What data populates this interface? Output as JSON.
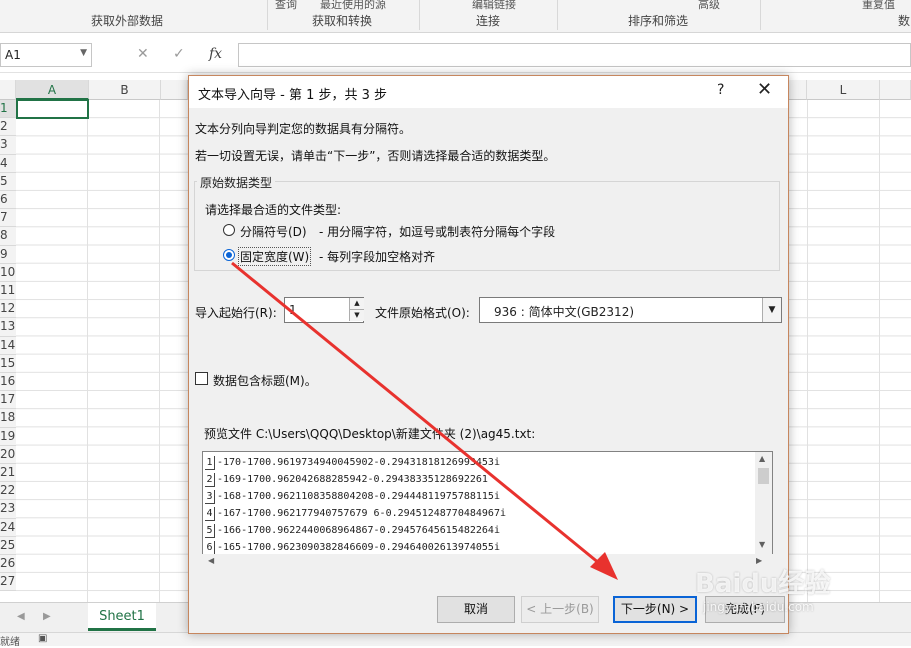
{
  "ribbon": {
    "groups": [
      "获取外部数据",
      "获取和转换",
      "连接",
      "排序和筛选",
      "数"
    ],
    "top_partial": [
      "查询",
      "最近使用的源",
      "编辑链接",
      "高级",
      "重复值"
    ]
  },
  "formula_bar": {
    "name_box": "A1",
    "cancel_icon": "✕",
    "enter_icon": "✓",
    "fx_icon": "fx"
  },
  "sheet": {
    "columns": [
      "A",
      "B",
      "L"
    ],
    "rows": [
      "1",
      "2",
      "3",
      "4",
      "5",
      "6",
      "7",
      "8",
      "9",
      "10",
      "11",
      "12",
      "13",
      "14",
      "15",
      "16",
      "17",
      "18",
      "19",
      "20",
      "21",
      "22",
      "23",
      "24",
      "25",
      "26",
      "27"
    ],
    "tab": "Sheet1",
    "status": "就绪"
  },
  "dialog": {
    "title": "文本导入向导 - 第 1 步，共 3 步",
    "help": "?",
    "close": "✕",
    "intro1": "文本分列向导判定您的数据具有分隔符。",
    "intro2": "若一切设置无误，请单击“下一步”，否则请选择最合适的数据类型。",
    "group_title": "原始数据类型",
    "choose_label": "请选择最合适的文件类型:",
    "option_delimited": "分隔符号(D)",
    "option_delimited_desc": "- 用分隔字符，如逗号或制表符分隔每个字段",
    "option_fixed": "固定宽度(W)",
    "option_fixed_desc": "- 每列字段加空格对齐",
    "start_row_label": "导入起始行(R):",
    "start_row_value": "1",
    "origin_label": "文件原始格式(O):",
    "origin_value": "936 : 简体中文(GB2312)",
    "header_checkbox": "数据包含标题(M)。",
    "preview_label": "预览文件 C:\\Users\\QQQ\\Desktop\\新建文件夹 (2)\\ag45.txt:",
    "preview_rows": [
      {
        "n": "1",
        "text": "-170-1700.9619734940045902-0.29431818126993453i"
      },
      {
        "n": "2",
        "text": "-169-1700.962042688285942-0.29438335128692261"
      },
      {
        "n": "3",
        "text": "-168-1700.9621108358804208-0.29444811975788115i"
      },
      {
        "n": "4",
        "text": "-167-1700.962177940757679 6-0.29451248770484967i"
      },
      {
        "n": "5",
        "text": "-166-1700.9622440068964867-0.29457645615482264i"
      },
      {
        "n": "6",
        "text": "-165-1700.9623090382846609-0.29464002613974055i"
      }
    ],
    "buttons": {
      "cancel": "取消",
      "back": "< 上一步(B)",
      "next": "下一步(N) >",
      "finish": "完成(F)"
    }
  },
  "watermark": {
    "logo": "Baidu经验",
    "url": "jingyan.baidu.com"
  },
  "colors": {
    "excel_green": "#217346",
    "annotation_red": "#e8322e",
    "focus_blue": "#0a64d6"
  }
}
